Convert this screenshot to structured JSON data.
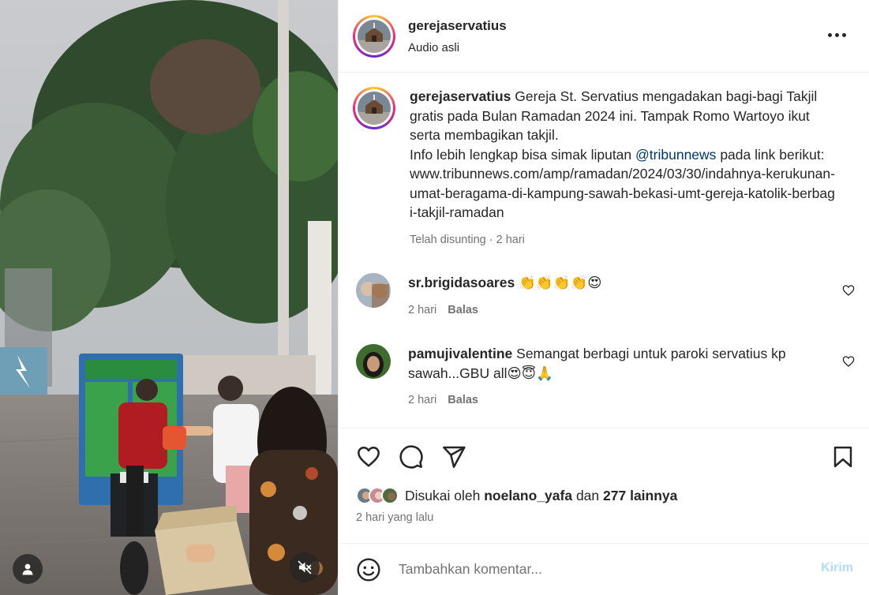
{
  "post": {
    "username": "gerejaservatius",
    "audio": "Audio asli",
    "more_icon": "more-icon"
  },
  "caption": {
    "username": "gerejaservatius",
    "text_1": "Gereja St. Servatius mengadakan bagi-bagi Takjil gratis pada Bulan Ramadan 2024 ini. Tampak Romo Wartoyo ikut serta membagikan takjil.",
    "text_2": "Info lebih lengkap bisa simak liputan",
    "mention": "@tribunnews",
    "text_3": "pada link berikut:",
    "link_text": "www.tribunnews.com/amp/ramadan/2024/03/30/indahnya-kerukunan-umat-beragama-di-kampung-sawah-bekasi-umt-gereja-katolik-berbagi-takjil-ramadan",
    "meta": "Telah disunting · 2 hari"
  },
  "comments": [
    {
      "username": "sr.brigidasoares",
      "text": "👏👏👏👏😍",
      "time": "2 hari",
      "reply": "Balas"
    },
    {
      "username": "pamujivalentine",
      "text": "Semangat berbagi untuk paroki servatius kp sawah...GBU all😍😇🙏",
      "time": "2 hari",
      "reply": "Balas"
    }
  ],
  "likes": {
    "prefix": "Disukai oleh",
    "user": "noelano_yafa",
    "middle": "dan",
    "others": "277 lainnya"
  },
  "posted_ago": "2 hari yang lalu",
  "composer": {
    "placeholder": "Tambahkan komentar...",
    "post_label": "Kirim"
  },
  "colors": {
    "mention": "#00376b",
    "muted": "#737373",
    "post_disabled": "#b3dbff",
    "text": "#262626"
  }
}
